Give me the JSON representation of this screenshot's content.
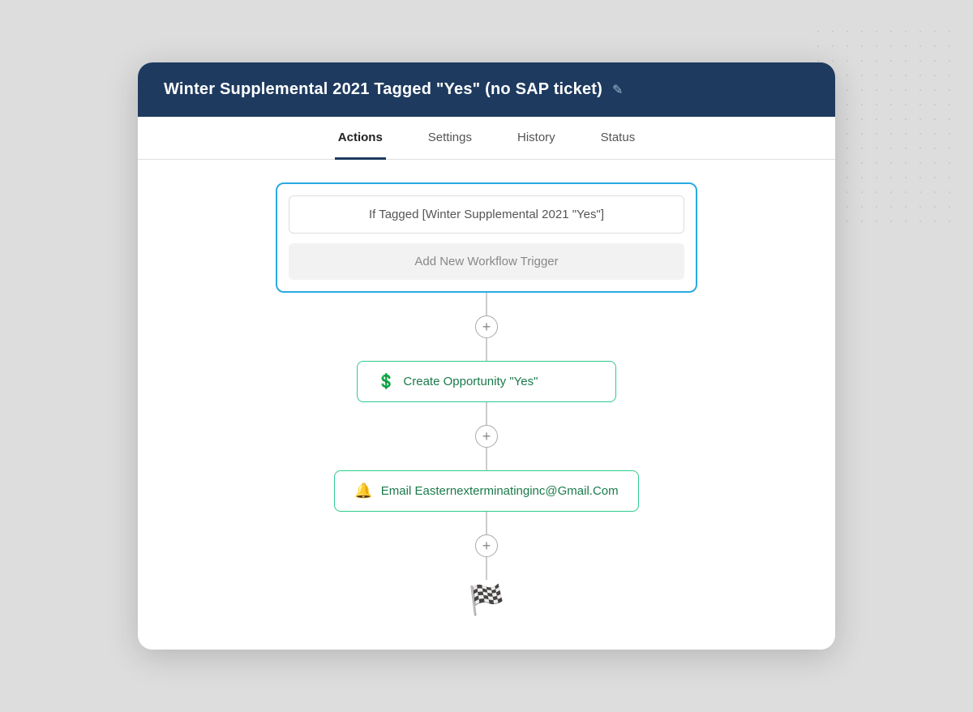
{
  "header": {
    "title": "Winter Supplemental 2021 Tagged \"Yes\" (no SAP ticket)",
    "edit_icon": "✎"
  },
  "tabs": [
    {
      "id": "actions",
      "label": "Actions",
      "active": true
    },
    {
      "id": "settings",
      "label": "Settings",
      "active": false
    },
    {
      "id": "history",
      "label": "History",
      "active": false
    },
    {
      "id": "status",
      "label": "Status",
      "active": false
    }
  ],
  "workflow": {
    "trigger_condition": "If Tagged [Winter Supplemental 2021 \"Yes\"]",
    "add_trigger_label": "Add New Workflow Trigger",
    "actions": [
      {
        "id": "create-opportunity",
        "icon": "💲",
        "label": "Create Opportunity \"Yes\""
      },
      {
        "id": "send-email",
        "icon": "🔔",
        "label": "Email Easternexterminatinginc@Gmail.Com"
      }
    ],
    "finish_icon": "🏁"
  }
}
